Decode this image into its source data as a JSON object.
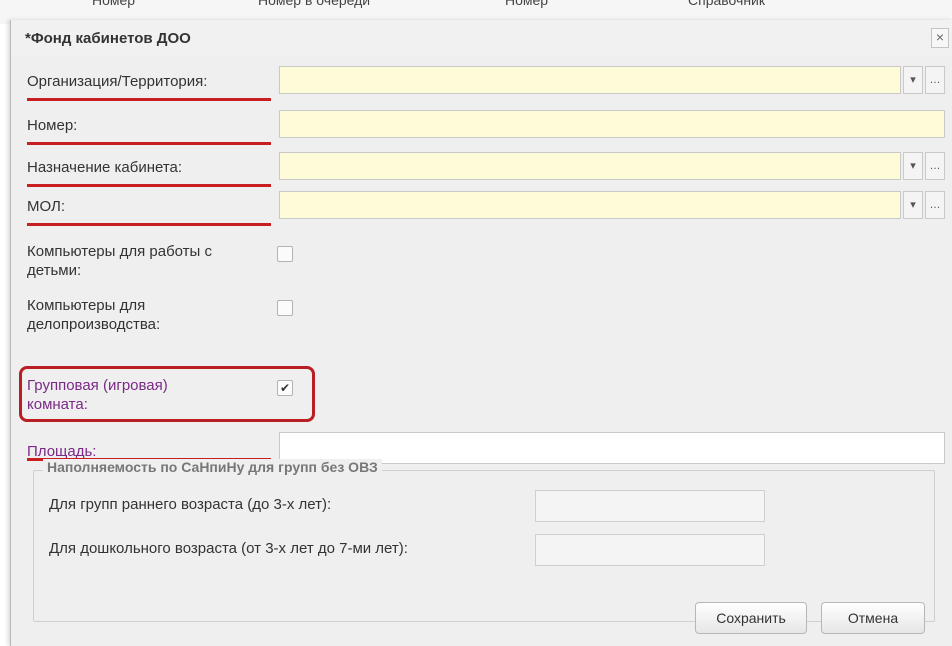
{
  "background_tabs": [
    "Номер",
    "Номер в очереди",
    "Номер",
    "Справочник"
  ],
  "dialog": {
    "title": "*Фонд кабинетов ДОО",
    "close_label": "×"
  },
  "fields": {
    "organization": {
      "label": "Организация/Территория:",
      "value": ""
    },
    "number": {
      "label": "Номер:",
      "value": ""
    },
    "purpose": {
      "label": "Назначение кабинета:",
      "value": ""
    },
    "mol": {
      "label": "МОЛ:",
      "value": ""
    },
    "area": {
      "label": "Площадь:",
      "value": ""
    }
  },
  "checkboxes": {
    "computers_children": {
      "label_line1": "Компьютеры для работы с",
      "label_line2": "детьми:",
      "checked": false
    },
    "computers_office": {
      "label_line1": "Компьютеры для",
      "label_line2": "делопроизводства:",
      "checked": false
    },
    "group_room": {
      "label_line1": "Групповая (игровая)",
      "label_line2": "комната:",
      "checked": true,
      "check_glyph": "✔"
    }
  },
  "combo": {
    "dropdown_glyph": "▾",
    "ellipsis_glyph": "…"
  },
  "fill_group": {
    "legend": "Наполняемость по СаНпиНу для групп без ОВЗ",
    "early_age_label": "Для групп раннего возраста (до 3-х лет):",
    "early_age_value": "",
    "preschool_label": "Для дошкольного возраста (от 3-х лет до 7-ми лет):",
    "preschool_value": ""
  },
  "buttons": {
    "save": "Сохранить",
    "cancel": "Отмена"
  },
  "colors": {
    "required_field_bg": "#fefcd8",
    "annotation_red": "#c81e22",
    "purple_label": "#7a2a86"
  }
}
